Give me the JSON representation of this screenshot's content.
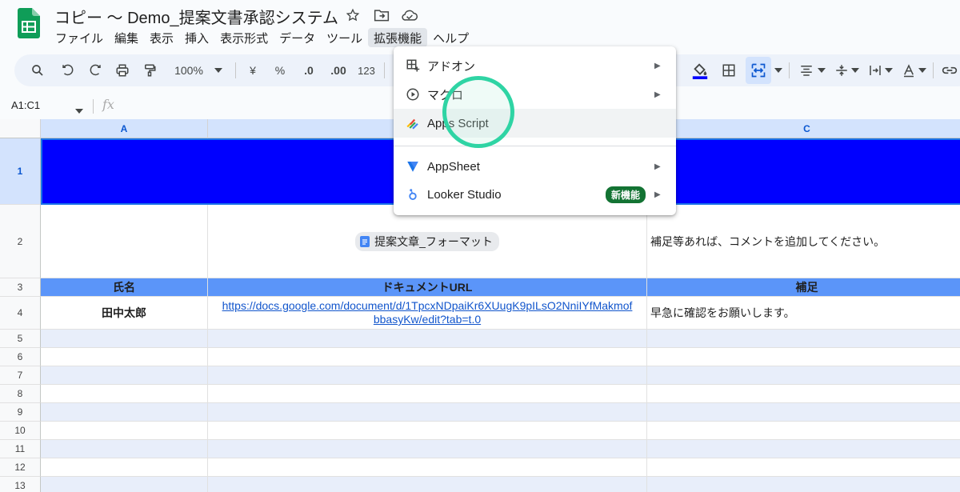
{
  "app": {
    "title": "コピー 〜 Demo_提案文書承認システム",
    "menus": [
      "ファイル",
      "編集",
      "表示",
      "挿入",
      "表示形式",
      "データ",
      "ツール",
      "拡張機能",
      "ヘルプ"
    ],
    "active_menu": "拡張機能"
  },
  "toolbar": {
    "zoom": "100%",
    "currency": "¥",
    "percent": "%",
    "dec_decrease": ".0",
    "dec_increase": ".00",
    "number_format": "123"
  },
  "formula_bar": {
    "name_box": "A1:C1",
    "fx": "fx"
  },
  "grid": {
    "columns": [
      "A",
      "",
      "C"
    ],
    "row_numbers": [
      "1",
      "2",
      "3",
      "4",
      "5",
      "6",
      "7",
      "8",
      "9",
      "10",
      "11",
      "12",
      "13"
    ],
    "row2": {
      "chip": "提案文章_フォーマット",
      "note": "補足等あれば、コメントを追加してください。"
    },
    "row3": {
      "a": "氏名",
      "b": "ドキュメントURL",
      "c": "補足"
    },
    "row4": {
      "a": "田中太郎",
      "b_line1": "https://docs.google.com/document/d/1TpcxNDpaiKr6XUugK9pILsO2NniIYfMakmof",
      "b_line2": "bbasyKw/edit?tab=t.0",
      "c": "早急に確認をお願いします。"
    }
  },
  "menu": {
    "items": [
      {
        "label": "アドオン",
        "icon": "addon-icon",
        "submenu": true
      },
      {
        "label": "マクロ",
        "icon": "macro-play-icon",
        "submenu": true
      },
      {
        "label": "Apps Script",
        "icon": "apps-script-icon",
        "submenu": false,
        "highlighted": true
      },
      {
        "label": "AppSheet",
        "icon": "appsheet-icon",
        "submenu": true
      },
      {
        "label": "Looker Studio",
        "icon": "looker-studio-icon",
        "submenu": true,
        "badge": "新機能"
      }
    ]
  },
  "colors": {
    "header_fill": "#0000ff",
    "table_header": "#5b95f9",
    "band": "#e8eefa",
    "accent": "#2fd4a4"
  }
}
